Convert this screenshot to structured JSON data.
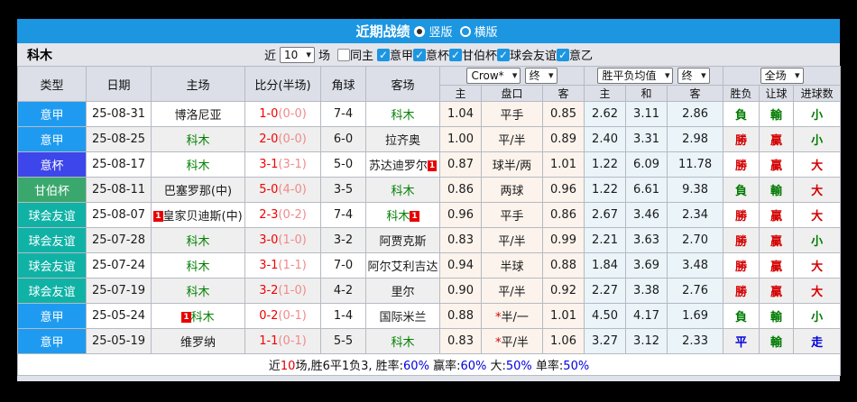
{
  "title_bar": {
    "title": "近期战绩",
    "options": [
      {
        "label": "竖版",
        "selected": true
      },
      {
        "label": "横版",
        "selected": false
      }
    ]
  },
  "filter_bar": {
    "team": "科木",
    "near_label": "近",
    "count_value": "10",
    "count_suffix": "场",
    "filters": [
      {
        "label": "同主",
        "checked": false
      },
      {
        "label": "意甲",
        "checked": true
      },
      {
        "label": "意杯",
        "checked": true
      },
      {
        "label": "甘伯杯",
        "checked": true
      },
      {
        "label": "球会友谊",
        "checked": true
      },
      {
        "label": "意乙",
        "checked": true
      }
    ]
  },
  "table": {
    "columns": {
      "type": "类型",
      "date": "日期",
      "home": "主场",
      "score": "比分(半场)",
      "corners": "角球",
      "away": "客场",
      "odds_home": "主",
      "odds_line": "盘口",
      "odds_away": "客",
      "avg_home": "主",
      "avg_draw": "和",
      "avg_away": "客",
      "result_wdl": "胜负",
      "result_handicap": "让球",
      "result_goals": "进球数"
    },
    "selects": {
      "odds_source": "Crow*",
      "odds_final": "终",
      "avg_source": "胜平负均值",
      "avg_final": "终",
      "scope": "全场"
    },
    "league_colors": {
      "意甲": "#1e9bf0",
      "意杯": "#3d46ea",
      "甘伯杯": "#3aa76d",
      "球会友谊": "#10b2a6"
    },
    "rows": [
      {
        "league": "意甲",
        "date": "25-08-31",
        "home": {
          "name": "博洛尼亚",
          "green": false,
          "badge": null
        },
        "score_ft": "1-0",
        "score_ht": "(0-0)",
        "corners": "7-4",
        "away": {
          "name": "科木",
          "green": true,
          "badge": null
        },
        "odds": [
          "1.04",
          "平手",
          "0.85"
        ],
        "line_star": false,
        "avg": [
          "2.62",
          "3.11",
          "2.86"
        ],
        "results": [
          {
            "text": "負",
            "c": "green"
          },
          {
            "text": "輸",
            "c": "green"
          },
          {
            "text": "小",
            "c": "green"
          }
        ]
      },
      {
        "league": "意甲",
        "date": "25-08-25",
        "home": {
          "name": "科木",
          "green": true,
          "badge": null
        },
        "score_ft": "2-0",
        "score_ht": "(0-0)",
        "corners": "6-0",
        "away": {
          "name": "拉齐奥",
          "green": false,
          "badge": null
        },
        "odds": [
          "1.00",
          "平/半",
          "0.89"
        ],
        "line_star": false,
        "avg": [
          "2.40",
          "3.31",
          "2.98"
        ],
        "results": [
          {
            "text": "勝",
            "c": "red"
          },
          {
            "text": "贏",
            "c": "red"
          },
          {
            "text": "小",
            "c": "green"
          }
        ]
      },
      {
        "league": "意杯",
        "date": "25-08-17",
        "home": {
          "name": "科木",
          "green": true,
          "badge": null
        },
        "score_ft": "3-1",
        "score_ht": "(3-1)",
        "corners": "5-0",
        "away": {
          "name": "苏达迪罗尔",
          "green": false,
          "badge": "after"
        },
        "odds": [
          "0.87",
          "球半/两",
          "1.01"
        ],
        "line_star": false,
        "avg": [
          "1.22",
          "6.09",
          "11.78"
        ],
        "results": [
          {
            "text": "勝",
            "c": "red"
          },
          {
            "text": "贏",
            "c": "red"
          },
          {
            "text": "大",
            "c": "red"
          }
        ]
      },
      {
        "league": "甘伯杯",
        "date": "25-08-11",
        "home": {
          "name": "巴塞罗那(中)",
          "green": false,
          "badge": null
        },
        "score_ft": "5-0",
        "score_ht": "(4-0)",
        "corners": "3-5",
        "away": {
          "name": "科木",
          "green": true,
          "badge": null
        },
        "odds": [
          "0.86",
          "两球",
          "0.96"
        ],
        "line_star": false,
        "avg": [
          "1.22",
          "6.61",
          "9.38"
        ],
        "results": [
          {
            "text": "負",
            "c": "green"
          },
          {
            "text": "輸",
            "c": "green"
          },
          {
            "text": "大",
            "c": "red"
          }
        ]
      },
      {
        "league": "球会友谊",
        "date": "25-08-07",
        "home": {
          "name": "皇家贝迪斯(中)",
          "green": false,
          "badge": "before"
        },
        "score_ft": "2-3",
        "score_ht": "(0-2)",
        "corners": "7-4",
        "away": {
          "name": "科木",
          "green": true,
          "badge": "after"
        },
        "odds": [
          "0.96",
          "平手",
          "0.86"
        ],
        "line_star": false,
        "avg": [
          "2.67",
          "3.46",
          "2.34"
        ],
        "results": [
          {
            "text": "勝",
            "c": "red"
          },
          {
            "text": "贏",
            "c": "red"
          },
          {
            "text": "大",
            "c": "red"
          }
        ]
      },
      {
        "league": "球会友谊",
        "date": "25-07-28",
        "home": {
          "name": "科木",
          "green": true,
          "badge": null
        },
        "score_ft": "3-0",
        "score_ht": "(1-0)",
        "corners": "3-2",
        "away": {
          "name": "阿贾克斯",
          "green": false,
          "badge": null
        },
        "odds": [
          "0.83",
          "平/半",
          "0.99"
        ],
        "line_star": false,
        "avg": [
          "2.21",
          "3.63",
          "2.70"
        ],
        "results": [
          {
            "text": "勝",
            "c": "red"
          },
          {
            "text": "贏",
            "c": "red"
          },
          {
            "text": "小",
            "c": "green"
          }
        ]
      },
      {
        "league": "球会友谊",
        "date": "25-07-24",
        "home": {
          "name": "科木",
          "green": true,
          "badge": null
        },
        "score_ft": "3-1",
        "score_ht": "(1-1)",
        "corners": "7-0",
        "away": {
          "name": "阿尔艾利吉达",
          "green": false,
          "badge": null
        },
        "odds": [
          "0.94",
          "半球",
          "0.88"
        ],
        "line_star": false,
        "avg": [
          "1.84",
          "3.69",
          "3.48"
        ],
        "results": [
          {
            "text": "勝",
            "c": "red"
          },
          {
            "text": "贏",
            "c": "red"
          },
          {
            "text": "大",
            "c": "red"
          }
        ]
      },
      {
        "league": "球会友谊",
        "date": "25-07-19",
        "home": {
          "name": "科木",
          "green": true,
          "badge": null
        },
        "score_ft": "3-2",
        "score_ht": "(1-0)",
        "corners": "4-2",
        "away": {
          "name": "里尔",
          "green": false,
          "badge": null
        },
        "odds": [
          "0.90",
          "平/半",
          "0.92"
        ],
        "line_star": false,
        "avg": [
          "2.27",
          "3.38",
          "2.76"
        ],
        "results": [
          {
            "text": "勝",
            "c": "red"
          },
          {
            "text": "贏",
            "c": "red"
          },
          {
            "text": "大",
            "c": "red"
          }
        ]
      },
      {
        "league": "意甲",
        "date": "25-05-24",
        "home": {
          "name": "科木",
          "green": true,
          "badge": "before"
        },
        "score_ft": "0-2",
        "score_ht": "(0-1)",
        "corners": "1-4",
        "away": {
          "name": "国际米兰",
          "green": false,
          "badge": null
        },
        "odds": [
          "0.88",
          "半/一",
          "1.01"
        ],
        "line_star": true,
        "avg": [
          "4.50",
          "4.17",
          "1.69"
        ],
        "results": [
          {
            "text": "負",
            "c": "green"
          },
          {
            "text": "輸",
            "c": "green"
          },
          {
            "text": "小",
            "c": "green"
          }
        ]
      },
      {
        "league": "意甲",
        "date": "25-05-19",
        "home": {
          "name": "维罗纳",
          "green": false,
          "badge": null
        },
        "score_ft": "1-1",
        "score_ht": "(0-1)",
        "corners": "5-5",
        "away": {
          "name": "科木",
          "green": true,
          "badge": null
        },
        "odds": [
          "0.83",
          "平/半",
          "1.06"
        ],
        "line_star": true,
        "avg": [
          "3.27",
          "3.12",
          "2.33"
        ],
        "results": [
          {
            "text": "平",
            "c": "blue"
          },
          {
            "text": "輸",
            "c": "green"
          },
          {
            "text": "走",
            "c": "blue"
          }
        ]
      }
    ]
  },
  "footer": {
    "segments": [
      {
        "text": "近",
        "c": "black"
      },
      {
        "text": "10",
        "c": "red"
      },
      {
        "text": "场,胜6平1负3, 胜率:",
        "c": "black"
      },
      {
        "text": "60%",
        "c": "blue"
      },
      {
        "text": " 赢率:",
        "c": "black"
      },
      {
        "text": "60%",
        "c": "blue"
      },
      {
        "text": " 大:",
        "c": "black"
      },
      {
        "text": "50%",
        "c": "blue"
      },
      {
        "text": " 单率:",
        "c": "black"
      },
      {
        "text": "50%",
        "c": "blue"
      }
    ]
  },
  "colors": {
    "accent_blue": "#1d96e2",
    "win_red": "#d40000",
    "lose_green": "#007a00",
    "draw_blue": "#0000d8",
    "score_fulltime_red": "#f20000",
    "score_halftime_pink": "#f08a8a",
    "badge_red": "#e80000"
  }
}
